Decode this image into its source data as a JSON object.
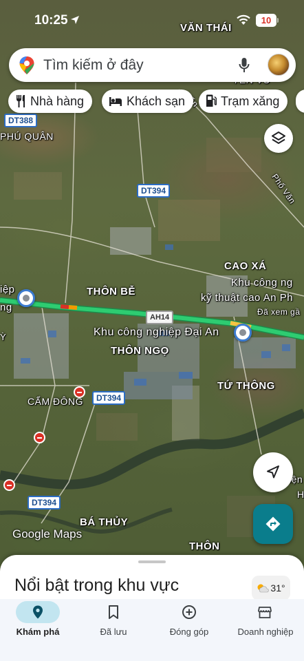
{
  "status_bar": {
    "time": "10:25",
    "battery": "10"
  },
  "search": {
    "placeholder": "Tìm kiếm ở đây"
  },
  "chips": [
    {
      "label": "Nhà hàng",
      "icon": "restaurant-icon"
    },
    {
      "label": "Khách sạn",
      "icon": "hotel-icon"
    },
    {
      "label": "Trạm xăng",
      "icon": "gas-station-icon"
    }
  ],
  "map": {
    "labels": {
      "van_thai": "VĂN THÁI",
      "yen_vu": "YÊN VŨ",
      "phu_quan": "PHÚ QUÂN",
      "thon_be": "THÔN BỄ",
      "cao_xa": "CAO XÁ",
      "khu_cong_nghe_cao_1": "Khu công ng",
      "khu_cong_nghe_cao_2": "kỹ thuật cao An Ph",
      "da_xem_ga": "Đã xem gầ",
      "kcn_dai_an": "Khu công nghiệp Đại An",
      "thon_ngo": "THÔN NGỌ",
      "tu_thong": "TỨ THÔNG",
      "cam_dong": "CẨM ĐÔNG",
      "ba_thuy": "BÁ THỦY",
      "thon_bottom": "THÔN",
      "pho_van": "Phố Văn",
      "van_road": "Văn",
      "hiep": "iệp",
      "ng": "ng",
      "y_left": "Ỳ",
      "right_edge_1": "iện",
      "right_edge_2": "H"
    },
    "shields": {
      "dt388": "DT388",
      "dt394_top": "DT394",
      "dt394_mid": "DT394",
      "dt394_bottom": "DT394",
      "ah14": "AH14"
    },
    "attribution": "Google Maps"
  },
  "sheet": {
    "title": "Nổi bật trong khu vực",
    "temperature": "31°"
  },
  "bottom_nav": [
    {
      "label": "Khám phá",
      "icon": "explore-pin-icon",
      "active": true
    },
    {
      "label": "Đã lưu",
      "icon": "bookmark-icon",
      "active": false
    },
    {
      "label": "Đóng góp",
      "icon": "add-circle-icon",
      "active": false
    },
    {
      "label": "Doanh nghiệp",
      "icon": "storefront-icon",
      "active": false
    }
  ],
  "colors": {
    "accent_teal": "#0a7d8c",
    "traffic_green": "#2ecc71",
    "traffic_red": "#d93025",
    "nav_active": "#c2e5f0"
  }
}
